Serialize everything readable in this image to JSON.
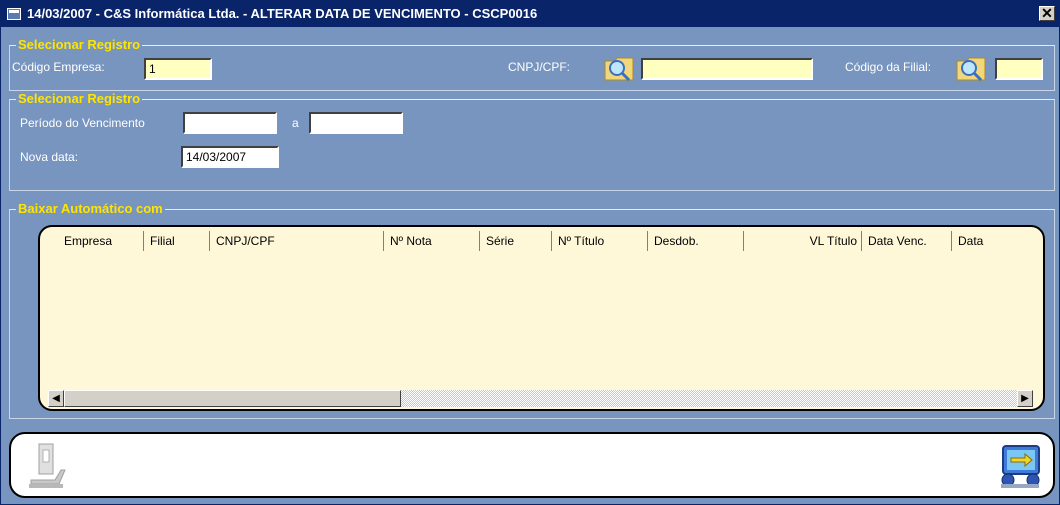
{
  "window": {
    "title": "14/03/2007  -  C&S Informática Ltda.  -  ALTERAR DATA DE VENCIMENTO  -  CSCP0016",
    "close": "✕"
  },
  "group1": {
    "legend": "Selecionar Registro",
    "codigo_empresa_label": "Código Empresa:",
    "codigo_empresa_value": "1",
    "cnpj_label": "CNPJ/CPF:",
    "cnpj_value": "",
    "codigo_filial_label": "Código da Filial:",
    "codigo_filial_value": ""
  },
  "group2": {
    "legend": "Selecionar Registro",
    "periodo_label": "Período do Vencimento",
    "periodo_from": "",
    "a_label": "a",
    "periodo_to": "",
    "nova_data_label": "Nova data:",
    "nova_data_value": "14/03/2007"
  },
  "group3": {
    "legend": "Baixar Automático com"
  },
  "grid": {
    "columns": [
      "Empresa",
      "Filial",
      "CNPJ/CPF",
      "Nº Nota",
      "Série",
      "Nº Título",
      "Desdob.",
      "VL Título",
      "Data Venc.",
      "Data"
    ]
  },
  "icons": {
    "search": "magnifier-folder-icon",
    "execute": "execute-icon",
    "exit": "exit-icon"
  }
}
